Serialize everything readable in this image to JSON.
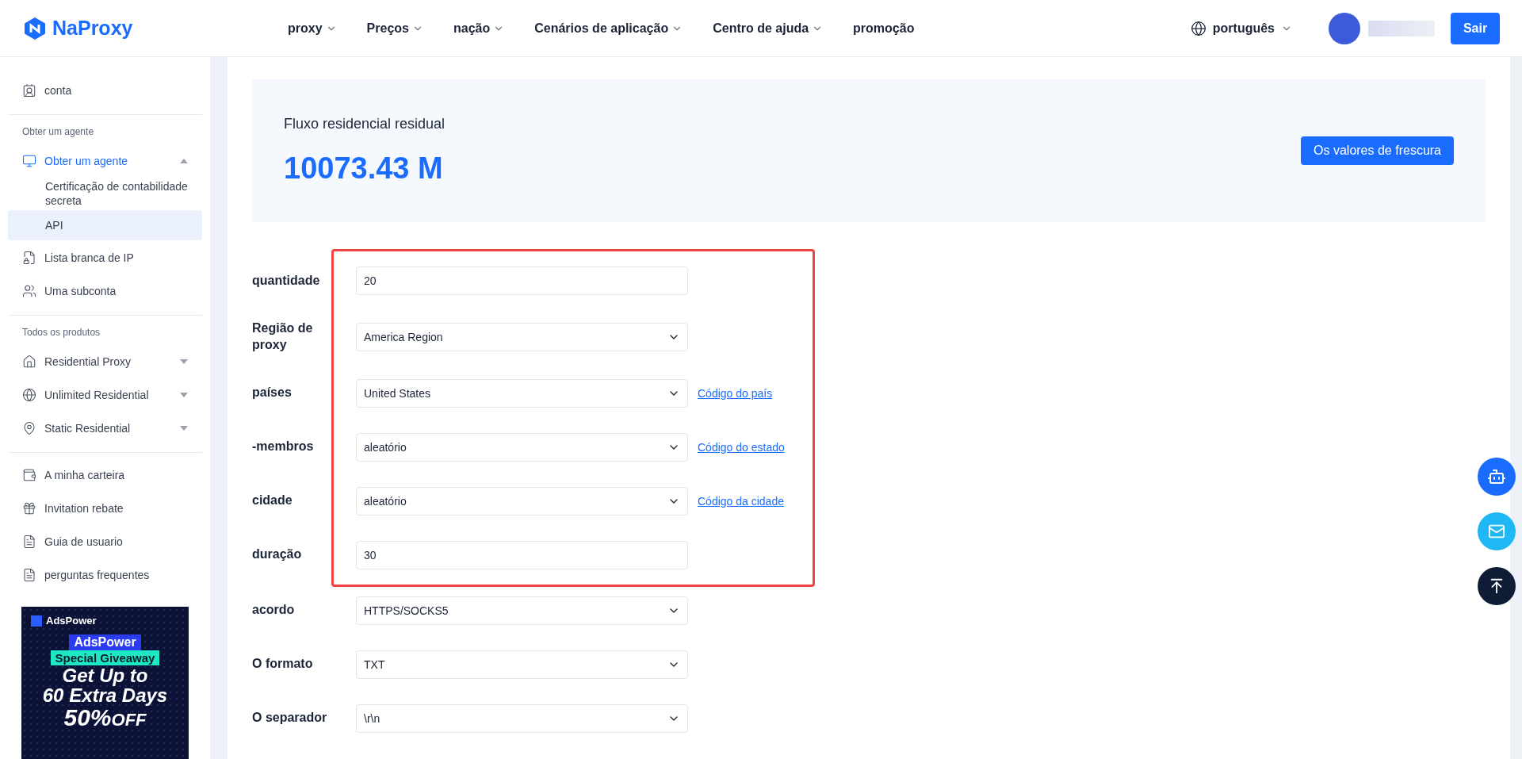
{
  "header": {
    "logo": "NaProxy",
    "nav": [
      {
        "label": "proxy",
        "dropdown": true
      },
      {
        "label": "Preços",
        "dropdown": true
      },
      {
        "label": "nação",
        "dropdown": true
      },
      {
        "label": "Cenários de aplicação",
        "dropdown": true
      },
      {
        "label": "Centro de ajuda",
        "dropdown": true
      },
      {
        "label": "promoção",
        "dropdown": false
      }
    ],
    "language": "português",
    "logout": "Sair"
  },
  "sidebar": {
    "groups": [
      {
        "items": [
          {
            "label": "conta",
            "selected": false
          }
        ]
      },
      {
        "heading": "Obter um agente",
        "items": [
          {
            "label": "Obter um agente",
            "selected": false,
            "expanded": true,
            "children": [
              {
                "label": "Certificação de contabilidade secreta",
                "selected": false
              },
              {
                "label": "API",
                "selected": true
              }
            ]
          },
          {
            "label": "Lista branca de IP",
            "selected": false
          },
          {
            "label": "Uma subconta",
            "selected": false
          }
        ]
      },
      {
        "heading": "Todos os produtos",
        "items": [
          {
            "label": "Residential Proxy",
            "selected": false,
            "expanded": false
          },
          {
            "label": "Unlimited Residential",
            "selected": false,
            "expanded": false
          },
          {
            "label": "Static Residential",
            "selected": false,
            "expanded": false
          }
        ]
      },
      {
        "items": [
          {
            "label": "A minha carteira",
            "selected": false
          },
          {
            "label": "Invitation rebate",
            "selected": false
          },
          {
            "label": "Guia de usuario",
            "selected": false
          },
          {
            "label": "perguntas frequentes",
            "selected": false
          }
        ]
      }
    ],
    "ad": {
      "brand": "AdsPower",
      "tag": "AdsPower",
      "subtitle": "Special Giveaway",
      "line_1": "Get Up to",
      "line_2": "60 Extra Days",
      "discount": "50%",
      "discount_label": "OFF"
    }
  },
  "balance": {
    "title": "Fluxo residencial residual",
    "value": "10073.43 M",
    "button": "Os valores de frescura"
  },
  "form": {
    "groups": [
      {
        "highlighted": true,
        "rows": [
          {
            "label": "quantidade",
            "kind": "input",
            "value": "20"
          },
          {
            "label": "Região de proxy",
            "kind": "select",
            "value": "America Region"
          },
          {
            "label": "países",
            "kind": "select",
            "value": "United States",
            "link": "Código do país"
          },
          {
            "label": "-membros",
            "kind": "select",
            "value": "aleatório",
            "link": "Código do estado"
          },
          {
            "label": "cidade",
            "kind": "select",
            "value": "aleatório",
            "link": "Código da cidade"
          },
          {
            "label": "duração",
            "kind": "input",
            "value": "30"
          }
        ]
      },
      {
        "highlighted": false,
        "rows": [
          {
            "label": "acordo",
            "kind": "select",
            "value": "HTTPS/SOCKS5"
          },
          {
            "label": "O formato",
            "kind": "select",
            "value": "TXT"
          },
          {
            "label": "O separador",
            "kind": "select",
            "value": "\\r\\n"
          }
        ]
      }
    ]
  }
}
